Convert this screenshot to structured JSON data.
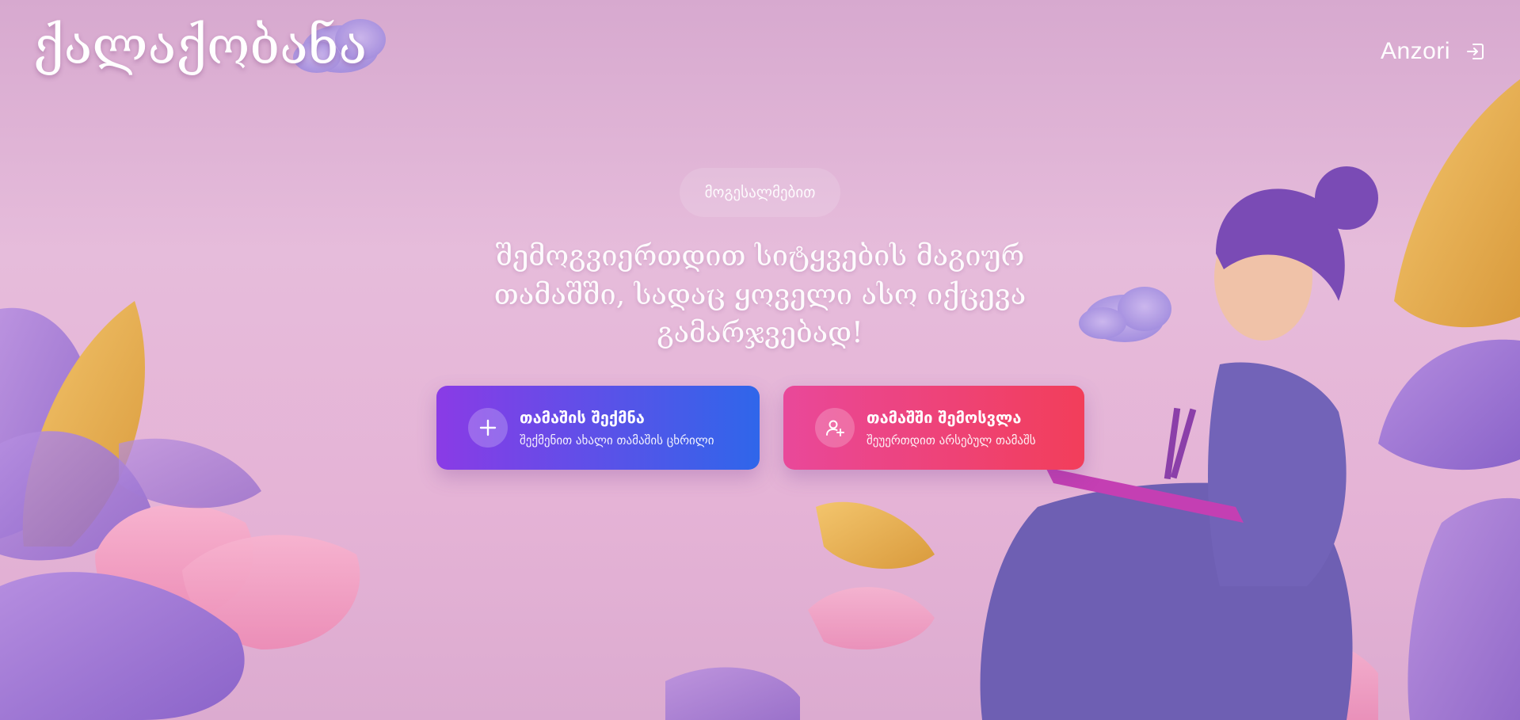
{
  "header": {
    "logo": "ქალაქობანა",
    "user_name": "Anzori",
    "logout_icon": "logout-icon"
  },
  "hero": {
    "welcome": "მოგესალმებით",
    "tagline": "შემოგვიერთდით სიტყვების მაგიურ თამაშში, სადაც ყოველი ასო იქცევა გამარჯვებად!"
  },
  "actions": {
    "create": {
      "title": "თამაშის შექმნა",
      "subtitle": "შექმენით ახალი თამაშის ცხრილი",
      "icon": "plus-icon"
    },
    "join": {
      "title": "თამაშში შემოსვლა",
      "subtitle": "შეუერთდით არსებულ თამაშს",
      "icon": "add-user-icon"
    }
  },
  "colors": {
    "create_gradient": [
      "#8a3be6",
      "#2f66ea"
    ],
    "join_gradient": [
      "#e9489a",
      "#f23e5a"
    ],
    "background": "#e5b8d7"
  }
}
